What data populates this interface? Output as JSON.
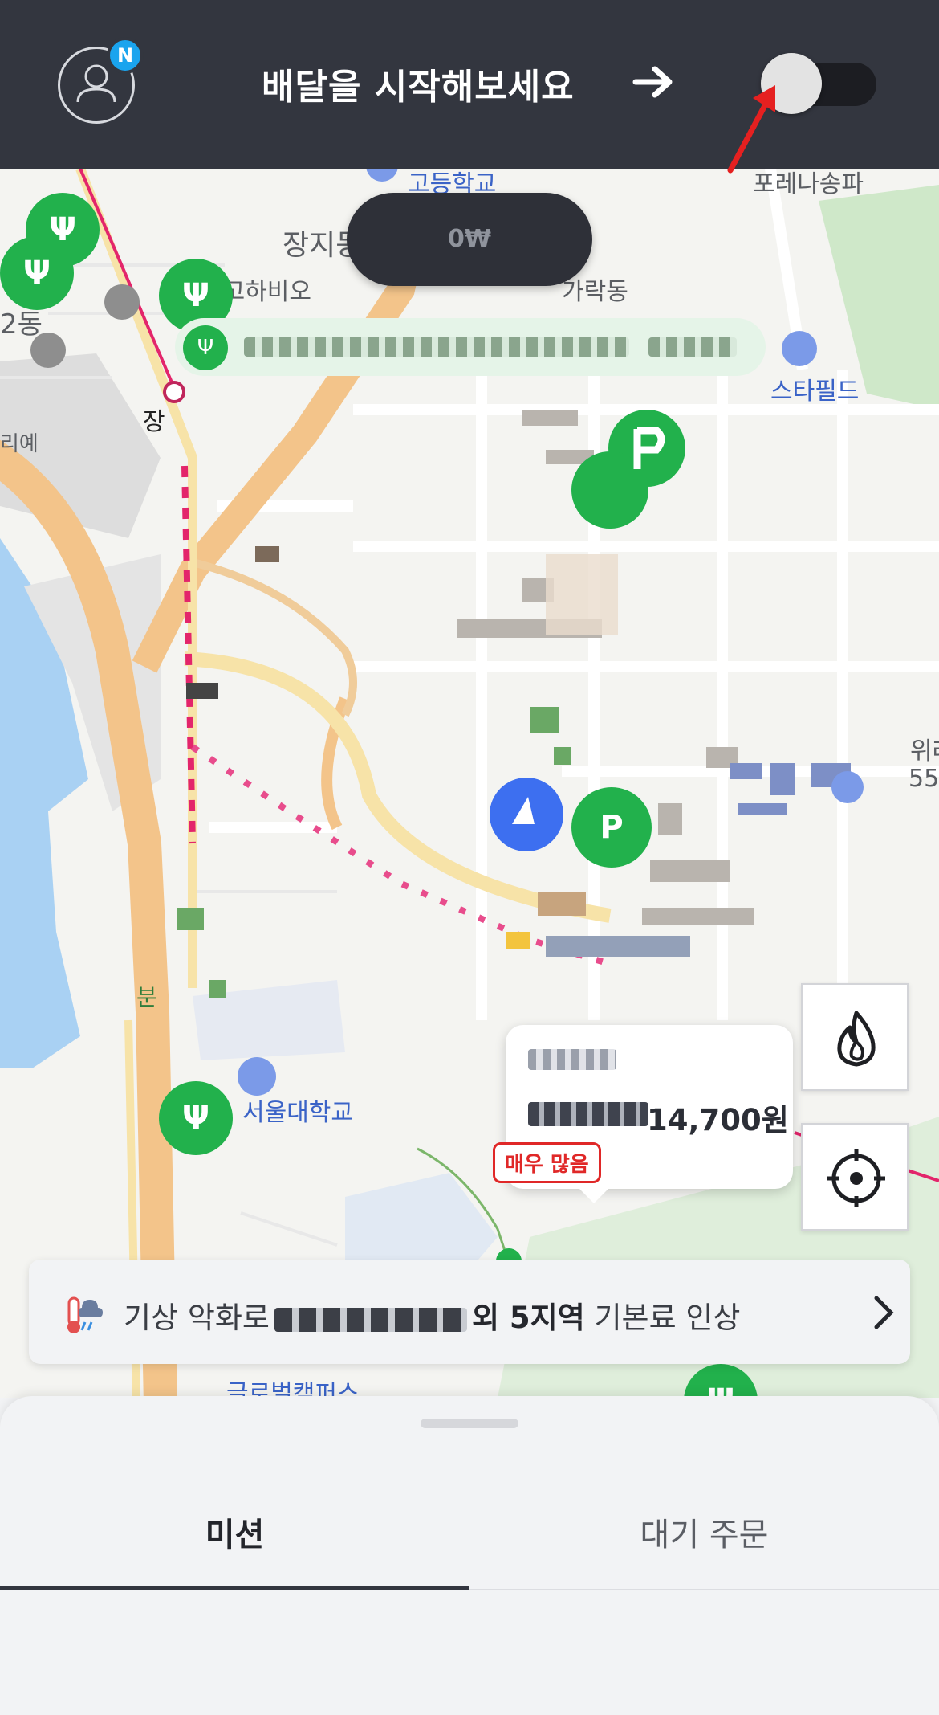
{
  "header": {
    "avatar_badge": "N",
    "title": "배달을 시작해보세요",
    "toggle_on": false
  },
  "map": {
    "earnings_pill": "0₩",
    "labels": {
      "school_top": "고등학교",
      "jangji": "장지동",
      "garak": "가락동",
      "lotte": "포레나송파",
      "starfield": "스타필드",
      "pharm": "사고하비오",
      "jang": "장",
      "dong2": "2동",
      "ri": "리예",
      "bun": "분",
      "univ": "서울대학교",
      "right_edge": "위례",
      "right_num": "55",
      "global_campus": "글로벌캠퍼스"
    },
    "info_card": {
      "price": "14,700원",
      "badge": "매우 많음"
    }
  },
  "notice": {
    "prefix": "기상 악화로",
    "region_suffix": "외 5지역",
    "suffix": "기본료 인상"
  },
  "tabs": {
    "mission": "미션",
    "waiting": "대기 주문"
  },
  "colors": {
    "topbar": "#33363f",
    "pin_green": "#22b14c",
    "badge_blue": "#1aa4ee",
    "alert_red": "#e02828",
    "my_location_blue": "#3d6ff0"
  }
}
